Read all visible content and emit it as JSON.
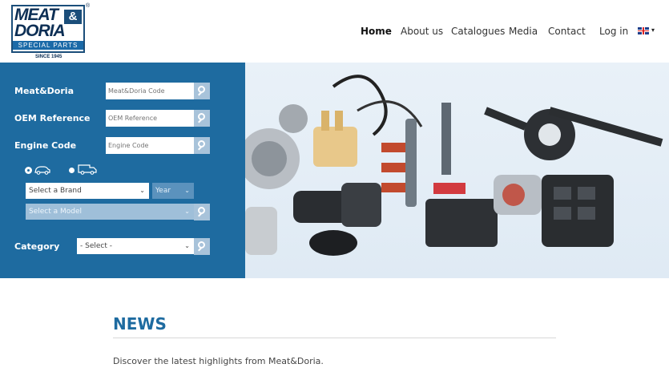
{
  "logo": {
    "line1": "MEAT",
    "ampersand": "&",
    "line2": "DORIA",
    "tagline": "SPECIAL PARTS",
    "since": "SINCE 1945",
    "registered": "®"
  },
  "nav": {
    "items": [
      "Home",
      "About us",
      "Catalogues",
      "Media",
      "Contact"
    ],
    "active": "Home",
    "login": "Log in",
    "language_caret": "▾"
  },
  "search": {
    "meat_doria": {
      "label": "Meat&Doria",
      "placeholder": "Meat&Doria Code"
    },
    "oem": {
      "label": "OEM Reference",
      "placeholder": "OEM Reference"
    },
    "engine": {
      "label": "Engine Code",
      "placeholder": "Engine Code"
    },
    "brand_select": "Select a Brand",
    "year_select": "Year",
    "model_select": "Select a Model",
    "category": {
      "label": "Category",
      "value": "- Select -"
    },
    "vehicle_types": [
      "car-icon",
      "van-icon"
    ],
    "selected_vehicle": "car-icon"
  },
  "news": {
    "title": "NEWS",
    "intro": "Discover the latest highlights from Meat&Doria."
  },
  "colors": {
    "brand_blue": "#1e6ba0",
    "logo_navy": "#0d2f55",
    "search_button": "#a8c3da"
  }
}
